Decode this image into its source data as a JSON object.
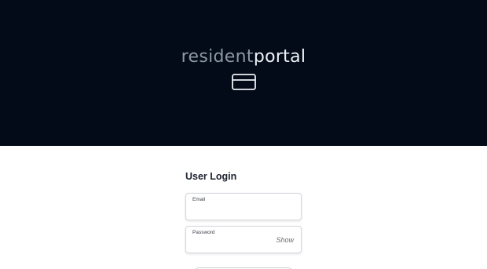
{
  "header": {
    "logo_part1": "resident",
    "logo_part2": "portal",
    "icon": "credit-card-icon",
    "background_color": "#030b18"
  },
  "login": {
    "title": "User Login",
    "email": {
      "label": "Email",
      "value": ""
    },
    "password": {
      "label": "Password",
      "value": "",
      "toggle_label": "Show"
    }
  }
}
